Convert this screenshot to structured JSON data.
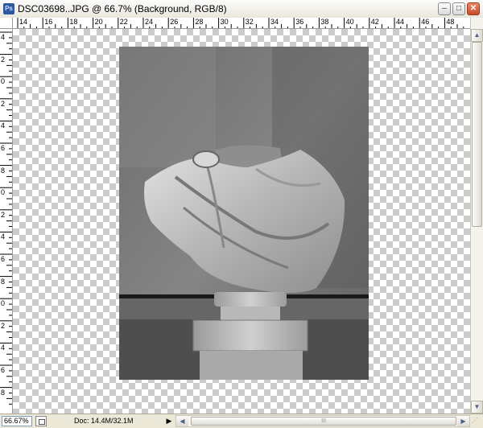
{
  "window": {
    "title": "DSC03698..JPG @ 66.7% (Background, RGB/8)",
    "app_icon_text": "Ps",
    "minimize_glyph": "‒",
    "maximize_glyph": "□",
    "close_glyph": "✕"
  },
  "rulers": {
    "top_labels": [
      "14",
      "16",
      "18",
      "20",
      "22",
      "24",
      "26",
      "28",
      "30",
      "32",
      "34",
      "36",
      "38",
      "40",
      "42",
      "44",
      "46",
      "48"
    ],
    "left_labels": [
      "4",
      "2",
      "0",
      "2",
      "4",
      "6",
      "8",
      "0",
      "2",
      "4",
      "6",
      "8",
      "0",
      "2",
      "4",
      "6",
      "8"
    ]
  },
  "status": {
    "zoom": "66.67%",
    "doc": "Doc: 14.4M/32.1M",
    "arrow_right": "▶",
    "arrow_left": "◀",
    "thumb_grip": "III"
  },
  "scroll": {
    "up": "▲",
    "down": "▼",
    "left": "◀",
    "right": "▶"
  },
  "colors": {
    "wall": "#7a7a7a",
    "statue": "#c8c8c8"
  }
}
